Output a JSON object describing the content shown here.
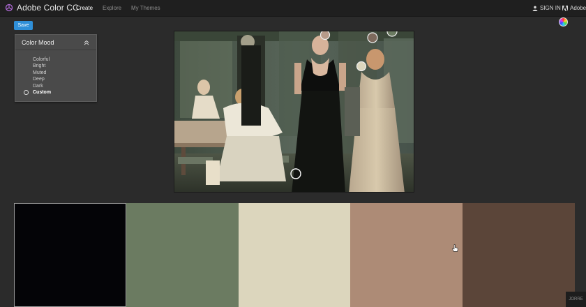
{
  "app": {
    "title": "Adobe Color CC",
    "logo_icon": "creative-cloud-icon"
  },
  "nav": {
    "create": "Create",
    "explore": "Explore",
    "my_themes": "My Themes",
    "active": "create"
  },
  "account": {
    "sign_in": "SIGN IN",
    "adobe": "Adobe",
    "sign_in_icon": "user-icon",
    "adobe_icon": "adobe-logo-icon"
  },
  "toolbar": {
    "save_label": "Save",
    "color_wheel_icon": "color-wheel-icon",
    "save_color": "#2f8fd8"
  },
  "color_mood": {
    "title": "Color Mood",
    "collapse_icon": "chevron-up-icon",
    "options": [
      "Colorful",
      "Bright",
      "Muted",
      "Deep",
      "Dark",
      "Custom"
    ],
    "selected": "Custom"
  },
  "image": {
    "picker_icon": "color-picker-circle-icon"
  },
  "swatches": {
    "colors": [
      "#040407",
      "#6b7b61",
      "#dcd6bd",
      "#ad8b76",
      "#5b4539"
    ],
    "active_index": 0
  },
  "watermark": {
    "text": "JORRE"
  }
}
